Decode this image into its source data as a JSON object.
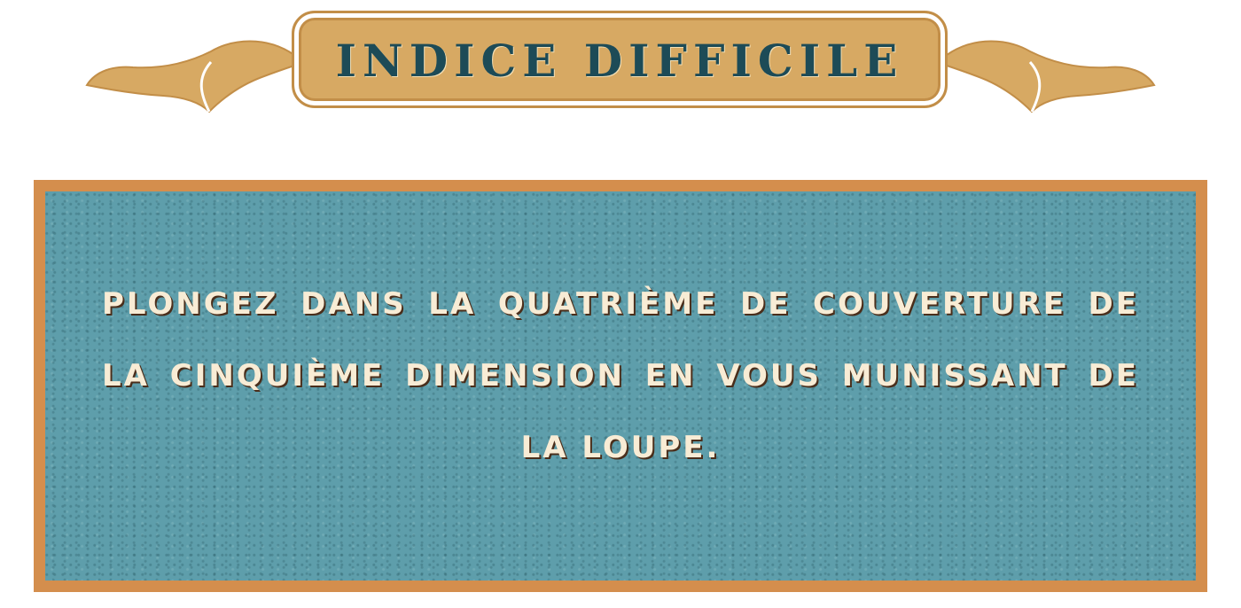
{
  "banner": {
    "title": "Indice difficile"
  },
  "hint": {
    "text": "Plongez dans la quatrième de couverture de la cinquième dimension en vous munissant de la loupe."
  },
  "colors": {
    "banner_fill": "#d7a963",
    "banner_text": "#1d4b57",
    "panel_border": "#d48e4d",
    "panel_fill": "#5e9eab",
    "hint_text": "#f8ecd5"
  }
}
